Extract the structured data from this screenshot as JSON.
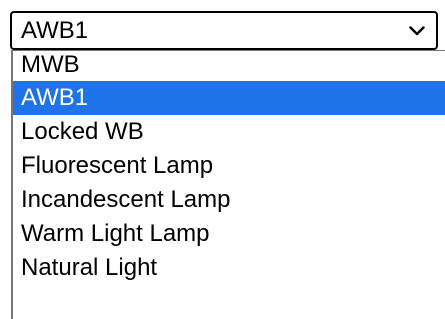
{
  "select": {
    "current_value": "AWB1"
  },
  "icons": {
    "chevron": "chevron-down-icon"
  },
  "colors": {
    "highlight": "#1e73e8",
    "highlight_text": "#ffffff",
    "border": "#000000"
  },
  "options": [
    {
      "label": "MWB"
    },
    {
      "label": "AWB1",
      "selected": true
    },
    {
      "label": "Locked WB"
    },
    {
      "label": "Fluorescent Lamp"
    },
    {
      "label": "Incandescent Lamp"
    },
    {
      "label": "Warm Light Lamp"
    },
    {
      "label": "Natural Light"
    }
  ]
}
